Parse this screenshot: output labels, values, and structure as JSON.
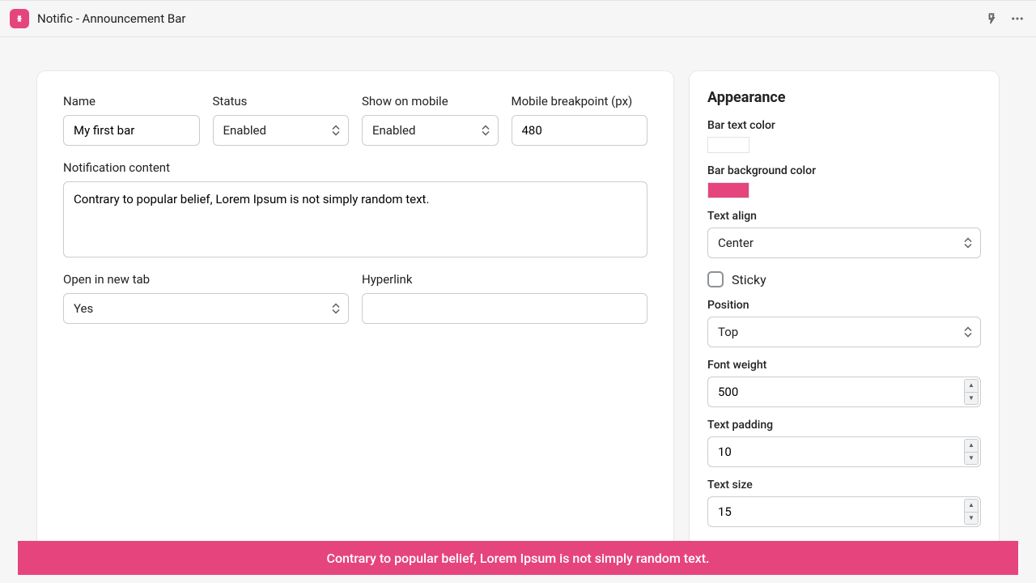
{
  "header": {
    "title": "Notific - Announcement Bar"
  },
  "main": {
    "name_label": "Name",
    "name_value": "My first bar",
    "status_label": "Status",
    "status_value": "Enabled",
    "show_mobile_label": "Show on mobile",
    "show_mobile_value": "Enabled",
    "breakpoint_label": "Mobile breakpoint (px)",
    "breakpoint_value": "480",
    "content_label": "Notification content",
    "content_value": "Contrary to popular belief, Lorem Ipsum is not simply random text.",
    "newtab_label": "Open in new tab",
    "newtab_value": "Yes",
    "hyperlink_label": "Hyperlink",
    "hyperlink_value": ""
  },
  "appearance": {
    "title": "Appearance",
    "text_color_label": "Bar text color",
    "text_color": "#ffffff",
    "bg_color_label": "Bar background color",
    "bg_color": "#e6447d",
    "text_align_label": "Text align",
    "text_align_value": "Center",
    "sticky_label": "Sticky",
    "sticky_checked": false,
    "position_label": "Position",
    "position_value": "Top",
    "font_weight_label": "Font weight",
    "font_weight_value": "500",
    "text_padding_label": "Text padding",
    "text_padding_value": "10",
    "text_size_label": "Text size",
    "text_size_value": "15"
  },
  "preview": {
    "text": "Contrary to popular belief, Lorem Ipsum is not simply random text."
  }
}
